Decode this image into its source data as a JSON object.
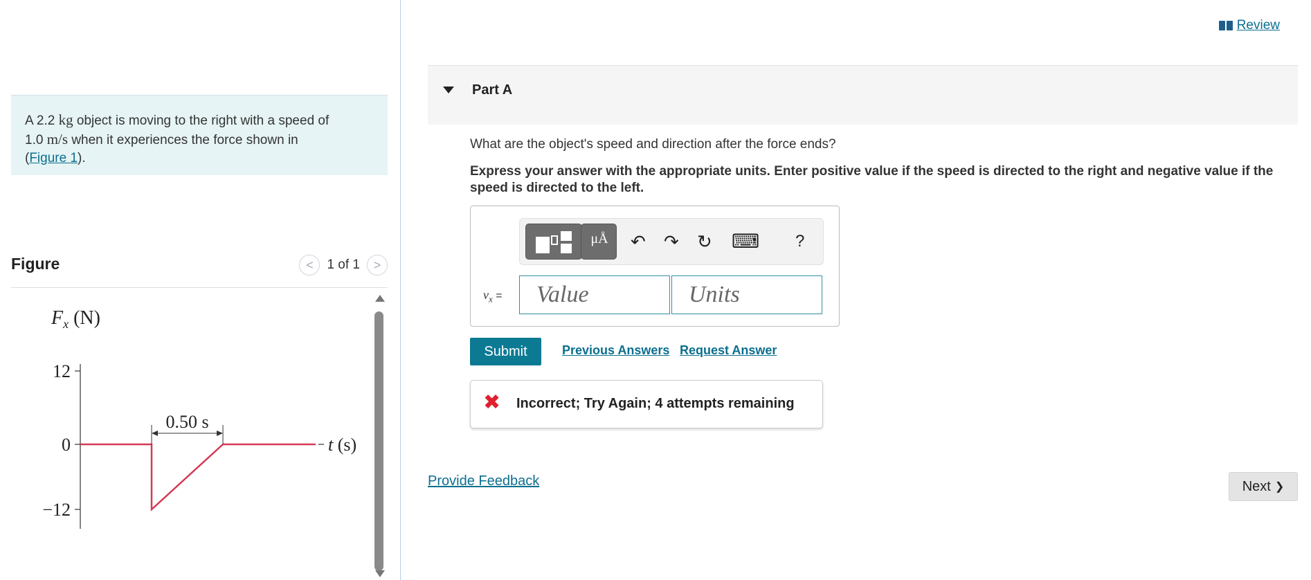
{
  "problem": {
    "pre": "A 2.2 ",
    "mass_unit": "kg",
    "mid": " object is moving to the right with a speed of",
    "speed": "1.0 ",
    "speed_unit": "m/s",
    "post": " when it experiences the force shown in",
    "link_open": "(",
    "link": "Figure 1",
    "link_close": ")."
  },
  "figure": {
    "title": "Figure",
    "pager": "1 of 1",
    "prev_glyph": "<",
    "next_glyph": ">"
  },
  "chart_data": {
    "type": "line",
    "title": "",
    "ylabel": "F_x (N)",
    "xlabel": "t (s)",
    "y_ticks": [
      "12",
      "0",
      "−12"
    ],
    "ylim": [
      -12,
      12
    ],
    "x_unit": "s",
    "series": [
      {
        "x": [
          0,
          0.5,
          0.5,
          1.0,
          1.0,
          1.65
        ],
        "y": [
          0,
          0,
          -12,
          0,
          0,
          0
        ]
      }
    ],
    "annotations": [
      "0.50 s"
    ],
    "line_color": "#d33a55",
    "grid": false
  },
  "review": {
    "label": "Review"
  },
  "part": {
    "title": "Part A"
  },
  "question": "What are the object's speed and direction after the force ends?",
  "instructions": "Express your answer with the appropriate units. Enter positive value if the speed is directed to the right and negative value if the speed is directed to the left.",
  "toolbar": {
    "units_label": "μÅ",
    "undo": "↶",
    "redo": "↷",
    "reset": "↻",
    "keyboard": "⌨",
    "help": "?"
  },
  "answer": {
    "variable": "v",
    "subscript": "x",
    "equals": " =",
    "value_placeholder": "Value",
    "units_placeholder": "Units"
  },
  "actions": {
    "submit": "Submit",
    "previous_answers": "Previous Answers",
    "request_answer": "Request Answer"
  },
  "feedback": {
    "icon": "✖",
    "text": "Incorrect; Try Again; 4 attempts remaining"
  },
  "footer": {
    "provide_feedback": "Provide Feedback",
    "next": "Next",
    "next_glyph": "❯"
  },
  "colors": {
    "accent": "#0d7a94",
    "problem_bg": "#e6f4f5",
    "error": "#e0202e"
  }
}
